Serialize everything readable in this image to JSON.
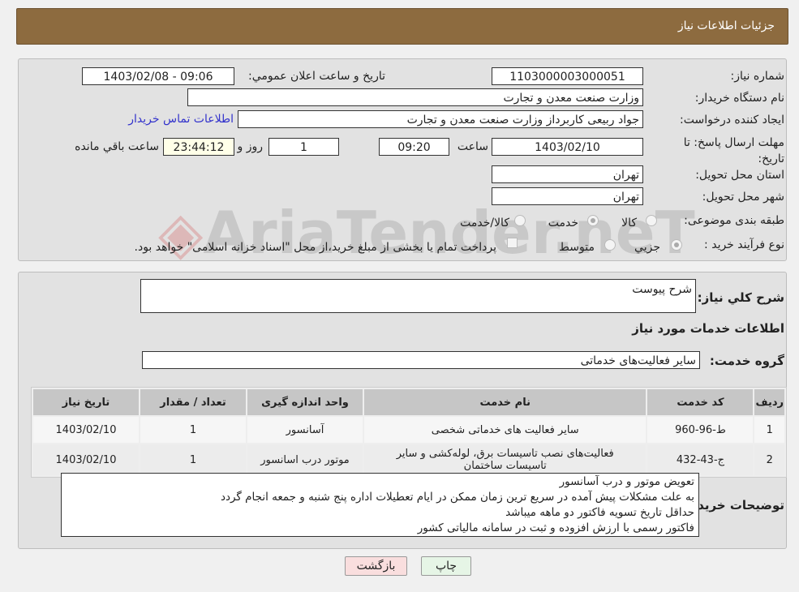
{
  "header": {
    "title": "جزئیات اطلاعات نیاز"
  },
  "fields": {
    "need_number_label": "شماره نیاز:",
    "need_number": "1103000003000051",
    "announce_label": "تاريخ و ساعت اعلان عمومي:",
    "announce_value": "1403/02/08 - 09:06",
    "buyer_org_label": "نام دستگاه خریدار:",
    "buyer_org": "وزارت صنعت معدن و تجارت",
    "creator_label": "ایجاد کننده درخواست:",
    "creator": "جواد ربیعی کاربرداز وزارت صنعت معدن و تجارت",
    "contact_link": "اطلاعات تماس خریدار",
    "deadline_label": "مهلت ارسال پاسخ: تا تاریخ:",
    "deadline_date": "1403/02/10",
    "time_label": "ساعت",
    "deadline_time": "09:20",
    "days": "1",
    "days_label": "روز و",
    "remaining": "23:44:12",
    "remaining_label": "ساعت باقي مانده",
    "province_label": "استان محل تحویل:",
    "province": "تهران",
    "city_label": "شهر محل تحویل:",
    "city": "تهران",
    "category_label": "طبقه بندی موضوعی:",
    "category_options": [
      "کالا",
      "خدمت",
      "کالا/خدمت"
    ],
    "category_selected": "خدمت",
    "process_label": "نوع فرآیند خرید :",
    "process_options": [
      "جزيي",
      "متوسط"
    ],
    "process_selected": "جزيي",
    "payment_note": "پرداخت تمام یا بخشی از مبلغ خرید،از محل \"اسناد خزانه اسلامی\" خواهد بود."
  },
  "summary": {
    "label": "شرح کلي نياز:",
    "value": "شرح  پیوست"
  },
  "services_title": "اطلاعات خدمات مورد نیاز",
  "service_group": {
    "label": "گروه خدمت:",
    "value": "سایر فعالیت‌های خدماتی"
  },
  "table": {
    "headers": [
      "رديف",
      "کد خدمت",
      "نام خدمت",
      "واحد اندازه گیری",
      "تعداد / مقدار",
      "تاریخ نیاز"
    ],
    "rows": [
      [
        "1",
        "ط-96-960",
        "سایر فعالیت های خدماتی شخصی",
        "آسانسور",
        "1",
        "1403/02/10"
      ],
      [
        "2",
        "ج-43-432",
        "فعالیت‌های نصب تاسیسات برق، لوله‌کشی و سایر تاسیسات ساختمان",
        "موتور درب اسانسور",
        "1",
        "1403/02/10"
      ]
    ]
  },
  "buyer_notes": {
    "label": "توضیحات خریدار:",
    "lines": [
      "تعویض موتور و درب آسانسور",
      "به علت مشکلات پیش آمده در سریع ترین زمان ممکن در ایام تعطیلات اداره  پنج شنبه و جمعه انجام گردد",
      "حداقل تاریخ تسویه فاکتور دو ماهه میباشد",
      "فاکتور رسمی با ارزش افزوده و ثبت در سامانه مالیاتی کشور"
    ]
  },
  "buttons": {
    "print": "چاپ",
    "back": "بازگشت"
  },
  "watermark": "AriaTender.neT",
  "colors": {
    "header": "#8d6b3f",
    "link": "#3333cc",
    "print_btn": "#e6f5e6",
    "back_btn": "#f9dede"
  }
}
